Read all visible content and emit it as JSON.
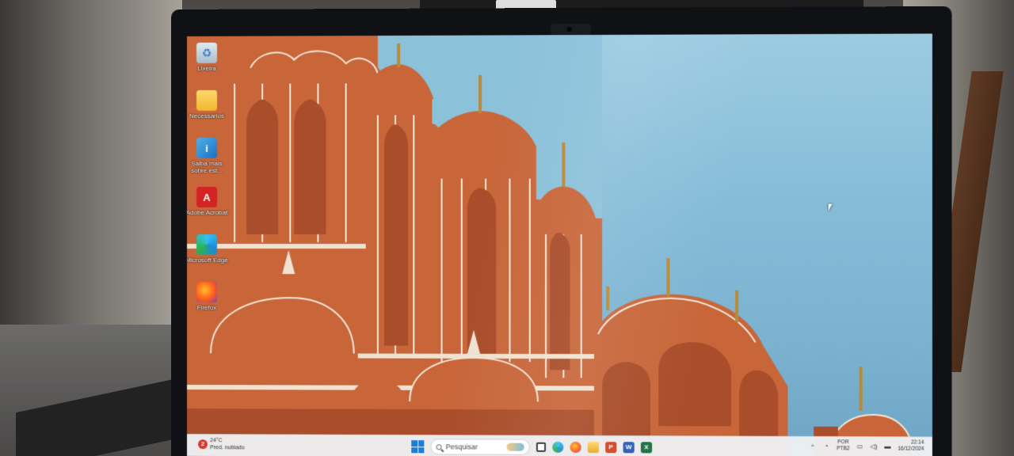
{
  "desktop": {
    "icons": [
      {
        "label": "Lixeira",
        "icon": "recycle-bin-icon"
      },
      {
        "label": "Necessarios",
        "icon": "folder-icon"
      },
      {
        "label": "Saiba mais sobre est...",
        "icon": "info-picture-icon"
      },
      {
        "label": "Adobe Acrobat",
        "icon": "adobe-acrobat-icon"
      },
      {
        "label": "Microsoft Edge",
        "icon": "edge-icon"
      },
      {
        "label": "Firefox",
        "icon": "firefox-icon"
      }
    ]
  },
  "taskbar": {
    "weather": {
      "badge": "2",
      "temperature": "24°C",
      "condition": "Pred. nublado"
    },
    "search_placeholder": "Pesquisar",
    "apps": [
      "start-icon",
      "search-icon",
      "task-view-icon",
      "edge-icon",
      "firefox-icon",
      "file-explorer-icon",
      "powerpoint-icon",
      "word-icon",
      "excel-icon"
    ],
    "tray": {
      "language": "POR",
      "layout": "PTB2",
      "time": "22:14",
      "date": "16/12/2024"
    }
  },
  "colors": {
    "taskbar_bg": "#eef0f4",
    "sky": "#86bcd8",
    "palace": "#c8663a",
    "accent": "#1a7fd8"
  }
}
